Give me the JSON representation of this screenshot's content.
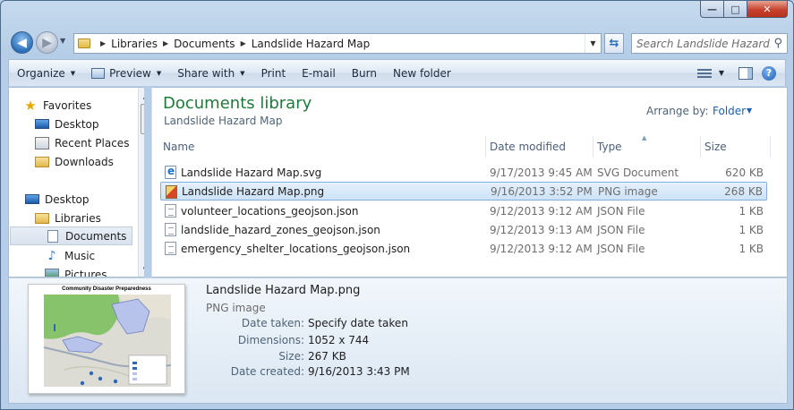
{
  "window": {
    "min_glyph": "—",
    "max_glyph": "□",
    "close_glyph": "✕"
  },
  "address": {
    "crumbs": [
      "Libraries",
      "Documents",
      "Landslide Hazard Map"
    ],
    "search_placeholder": "Search Landslide Hazard..."
  },
  "toolbar": {
    "organize": "Organize",
    "preview": "Preview",
    "share_with": "Share with",
    "print": "Print",
    "email": "E-mail",
    "burn": "Burn",
    "new_folder": "New folder"
  },
  "nav": {
    "favorites": "Favorites",
    "desktop_fav": "Desktop",
    "recent_places": "Recent Places",
    "downloads": "Downloads",
    "desktop": "Desktop",
    "libraries": "Libraries",
    "documents": "Documents",
    "music": "Music",
    "pictures": "Pictures"
  },
  "library": {
    "title": "Documents library",
    "subtitle": "Landslide Hazard Map",
    "arrange_label": "Arrange by:",
    "arrange_value": "Folder"
  },
  "columns": {
    "name": "Name",
    "date": "Date modified",
    "type": "Type",
    "size": "Size"
  },
  "files": [
    {
      "name": "Landslide Hazard Map.svg",
      "date": "9/17/2013 9:45 AM",
      "type": "SVG Document",
      "size": "620 KB",
      "icon": "svg-file-icon"
    },
    {
      "name": "Landslide Hazard Map.png",
      "date": "9/16/2013 3:52 PM",
      "type": "PNG image",
      "size": "268 KB",
      "icon": "png-file-icon"
    },
    {
      "name": "volunteer_locations_geojson.json",
      "date": "9/12/2013 9:12 AM",
      "type": "JSON File",
      "size": "1 KB",
      "icon": "json-file-icon"
    },
    {
      "name": "landslide_hazard_zones_geojson.json",
      "date": "9/12/2013 9:13 AM",
      "type": "JSON File",
      "size": "1 KB",
      "icon": "json-file-icon"
    },
    {
      "name": "emergency_shelter_locations_geojson.json",
      "date": "9/12/2013 9:12 AM",
      "type": "JSON File",
      "size": "1 KB",
      "icon": "json-file-icon"
    }
  ],
  "details": {
    "filename": "Landslide Hazard Map.png",
    "filetype": "PNG image",
    "thumb_title": "Community Disaster Preparedness",
    "date_taken_label": "Date taken:",
    "date_taken_value": "Specify date taken",
    "dimensions_label": "Dimensions:",
    "dimensions_value": "1052 x 744",
    "size_label": "Size:",
    "size_value": "267 KB",
    "date_created_label": "Date created:",
    "date_created_value": "9/16/2013 3:43 PM"
  },
  "colors": {
    "library_title": "#1f7a3a",
    "link": "#1e5fb0",
    "selection": "#cde3f8"
  }
}
